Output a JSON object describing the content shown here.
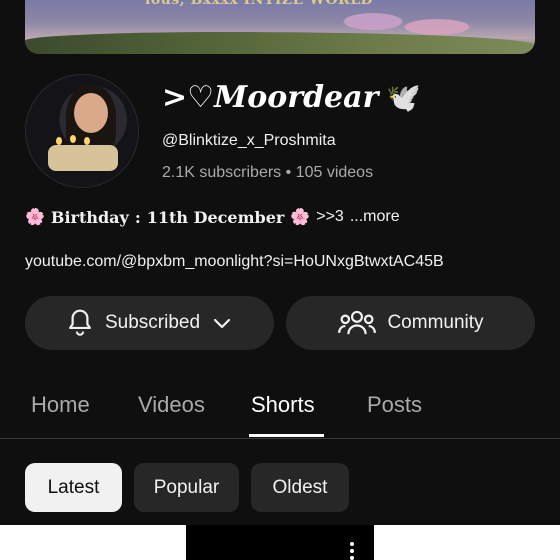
{
  "banner": {
    "text": "ious, Bxxxx INTIZE WORLD"
  },
  "channel": {
    "name_prefix": ">♡",
    "name": "Moordear",
    "dove_emoji": "🕊️",
    "handle": "@Blinktize_x_Proshmita",
    "subscribers": "2.1K subscribers",
    "videos": "105 videos",
    "description_emoji": "🌸",
    "description_label": "Birthday",
    "description_date": "11th December",
    "description_tail": ">>3",
    "more_label": "...more",
    "link": "youtube.com/@bpxbm_moonlight?si=HoUNxgBtwxtAC45B"
  },
  "buttons": {
    "subscribed_label": "Subscribed",
    "community_label": "Community"
  },
  "tabs": [
    {
      "label": "Home",
      "active": false
    },
    {
      "label": "Videos",
      "active": false
    },
    {
      "label": "Shorts",
      "active": true
    },
    {
      "label": "Posts",
      "active": false
    }
  ],
  "chips": [
    {
      "label": "Latest",
      "active": true
    },
    {
      "label": "Popular",
      "active": false
    },
    {
      "label": "Oldest",
      "active": false
    }
  ],
  "icons": {
    "bell": "bell-icon",
    "chevron": "chevron-down-icon",
    "community": "community-icon",
    "kebab": "more-vert-icon"
  }
}
